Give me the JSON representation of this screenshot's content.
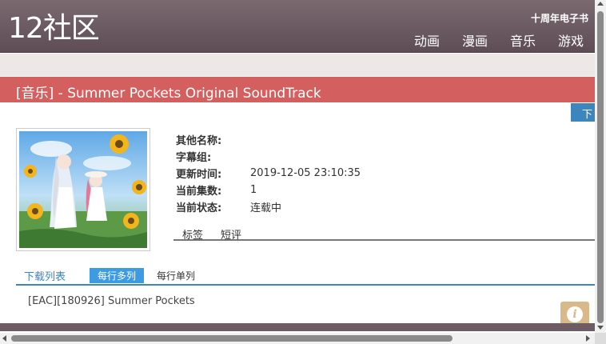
{
  "header": {
    "logo": "12社区",
    "anniversary": "十周年电子书",
    "nav": [
      "动画",
      "漫画",
      "音乐",
      "游戏"
    ]
  },
  "title": "[音乐] - Summer Pockets Original SoundTrack",
  "download_button_label": "下",
  "cover": {
    "icon": "cover-image"
  },
  "info": [
    {
      "key": "其他名称:",
      "value": ""
    },
    {
      "key": "字幕组:",
      "value": ""
    },
    {
      "key": "更新时间:",
      "value": "2019-12-05 23:10:35"
    },
    {
      "key": "当前集数:",
      "value": "1"
    },
    {
      "key": "当前状态:",
      "value": "连载中"
    }
  ],
  "subtabs": [
    "标签",
    "短评"
  ],
  "downloads": {
    "label": "下载列表",
    "tabs": [
      "每行多列",
      "每行单列"
    ],
    "active_tab": 0,
    "items": [
      "[EAC][180926] Summer Pockets"
    ]
  },
  "colors": {
    "header": "#6b5a62",
    "title_bar": "#d35f5f",
    "accent_blue": "#3d86bd",
    "info_fab": "#d9b98a"
  },
  "icons": {
    "info_fab": "info-icon"
  }
}
